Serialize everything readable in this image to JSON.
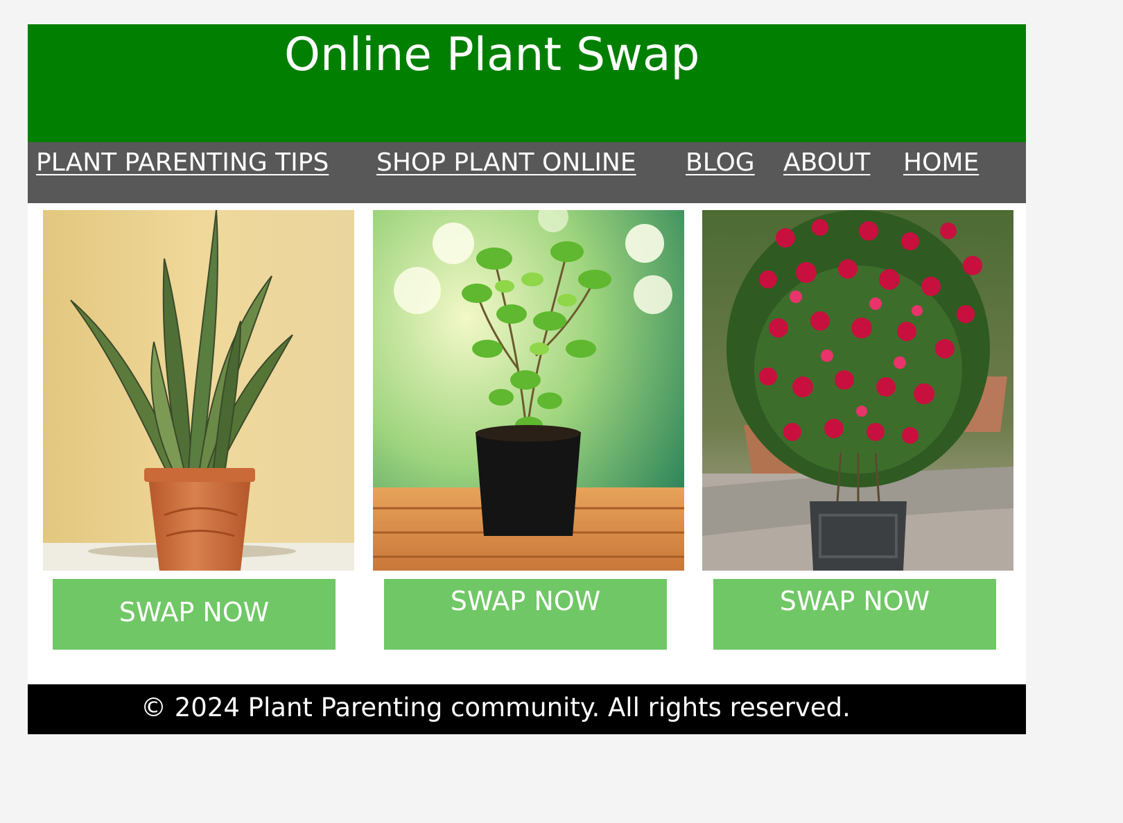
{
  "header": {
    "title": "Online Plant Swap"
  },
  "nav": {
    "items": [
      {
        "label": "PLANT PARENTING TIPS"
      },
      {
        "label": "SHOP PLANT ONLINE"
      },
      {
        "label": "BLOG"
      },
      {
        "label": "ABOUT"
      },
      {
        "label": "HOME"
      }
    ]
  },
  "cards": [
    {
      "image": "snake-plant-in-terracotta-pot",
      "button_label": "SWAP NOW"
    },
    {
      "image": "tulsi-plant-in-black-pot",
      "button_label": "SWAP NOW"
    },
    {
      "image": "red-rose-bush-in-planter",
      "button_label": "SWAP NOW"
    }
  ],
  "footer": {
    "text": "© 2024 Plant Parenting community. All rights reserved."
  },
  "colors": {
    "header_bg": "#007f00",
    "nav_bg": "#585858",
    "button_bg": "#70c766",
    "footer_bg": "#000000",
    "page_bg": "#f4f4f4"
  }
}
